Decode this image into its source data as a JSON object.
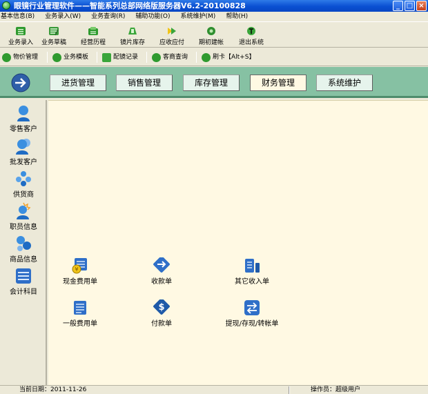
{
  "window": {
    "title": "眼镜行业管理软件——智能系列总部网络版服务器V6.2-20100828"
  },
  "menu": [
    {
      "label": "基本信息(B)"
    },
    {
      "label": "业务录入(W)"
    },
    {
      "label": "业务查询(R)"
    },
    {
      "label": "辅助功能(O)"
    },
    {
      "label": "系统维护(M)"
    },
    {
      "label": "帮助(H)"
    }
  ],
  "toolbar1": [
    {
      "label": "业务录入",
      "icon": "green-list-icon"
    },
    {
      "label": "业务草稿",
      "icon": "draft-icon"
    },
    {
      "label": "经营历程",
      "icon": "history-icon"
    },
    {
      "label": "镜片库存",
      "icon": "lens-stock-icon"
    },
    {
      "label": "应收应付",
      "icon": "receivable-icon"
    },
    {
      "label": "期初建帐",
      "icon": "initial-ledger-icon"
    },
    {
      "label": "退出系统",
      "icon": "exit-icon"
    }
  ],
  "toolbar2": [
    {
      "label": "物价管理",
      "icon": "question-icon"
    },
    {
      "label": "业务模板",
      "icon": "template-icon"
    },
    {
      "label": "配镜记录",
      "icon": "record-icon"
    },
    {
      "label": "客商查询",
      "icon": "customer-query-icon"
    },
    {
      "label": "刷卡【Alt+S】",
      "icon": "card-check-icon"
    }
  ],
  "nav_tabs": [
    {
      "label": "进货管理"
    },
    {
      "label": "销售管理"
    },
    {
      "label": "库存管理"
    },
    {
      "label": "财务管理",
      "active": true
    },
    {
      "label": "系统维护"
    }
  ],
  "sidebar": [
    {
      "label": "零售客户",
      "icon": "retail-customer-icon"
    },
    {
      "label": "批发客户",
      "icon": "wholesale-customer-icon"
    },
    {
      "label": "供货商",
      "icon": "supplier-icon"
    },
    {
      "label": "职员信息",
      "icon": "staff-icon"
    },
    {
      "label": "商品信息",
      "icon": "product-icon"
    },
    {
      "label": "会计科目",
      "icon": "account-subject-icon"
    }
  ],
  "functions": [
    {
      "label": "现金费用单",
      "icon": "cash-expense-icon"
    },
    {
      "label": "收款单",
      "icon": "receipt-arrow-icon"
    },
    {
      "label": "其它收入单",
      "icon": "other-income-icon"
    },
    {
      "label": "一般费用单",
      "icon": "general-expense-icon"
    },
    {
      "label": "付款单",
      "icon": "payment-dollar-icon"
    },
    {
      "label": "提现/存现/转帐单",
      "icon": "transfer-icon"
    }
  ],
  "status": {
    "date_label": "当前日期：2011-11-26",
    "operator_label": "操作员：超级用户"
  },
  "colors": {
    "nav_bg": "#86C1A3",
    "workspace_bg": "#FFF9E3",
    "title_blue": "#0A4FD2"
  }
}
